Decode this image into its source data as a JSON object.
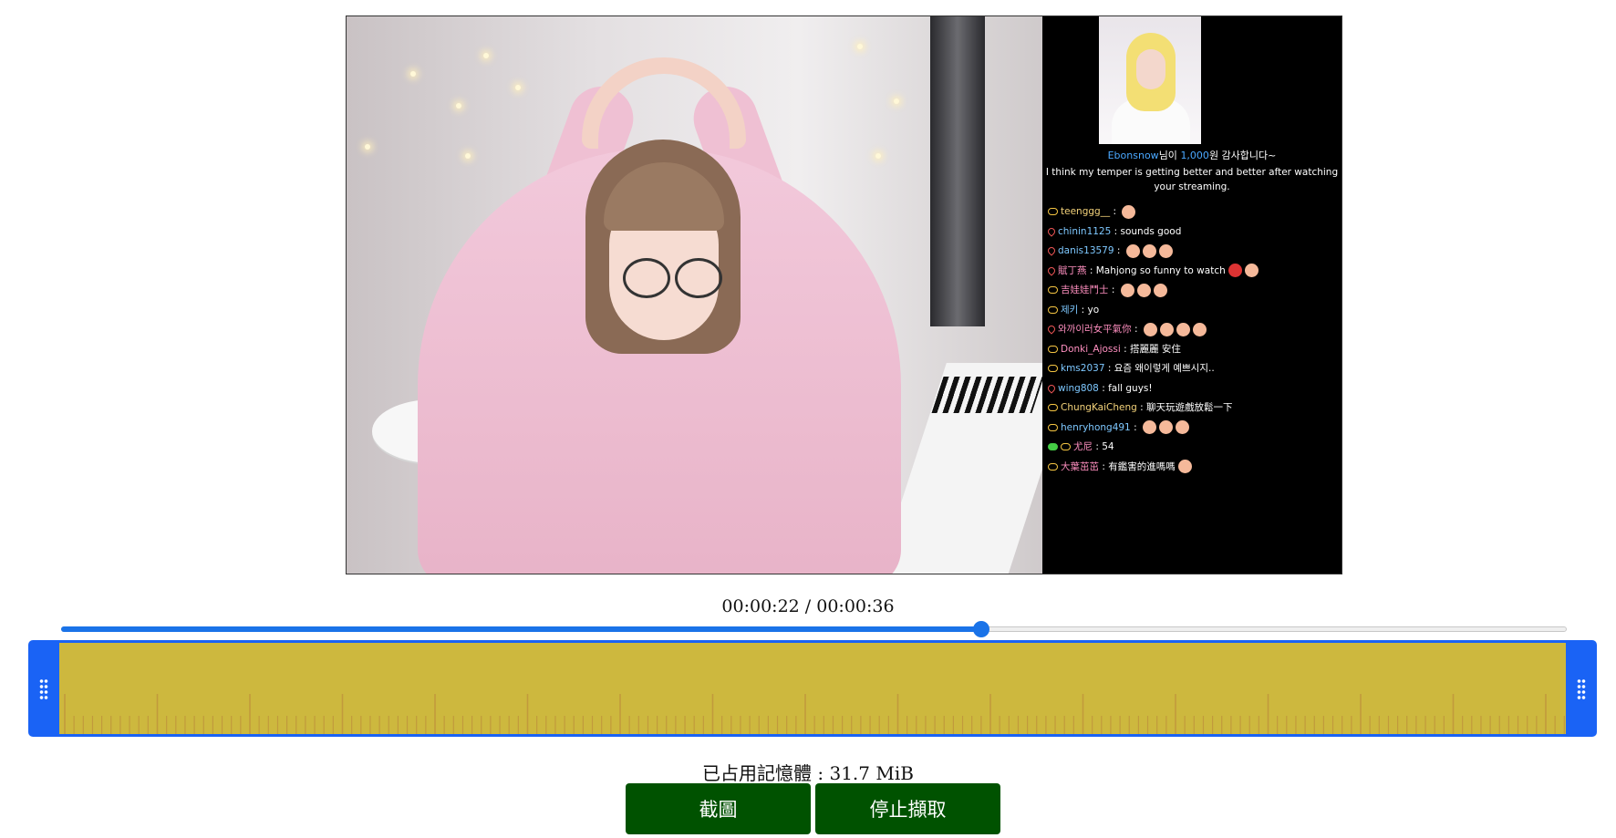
{
  "video": {
    "chat": {
      "donation": {
        "user": "Ebonsnow",
        "text_before": "님이 ",
        "amount": "1,000",
        "text_after": "원 감사합니다~",
        "message": "I think my temper is getting better and better after watching your streaming."
      },
      "messages": [
        {
          "user": "teenggg__",
          "text": " : "
        },
        {
          "user": "chinin1125",
          "text": " : sounds good"
        },
        {
          "user": "danis13579",
          "text": " : "
        },
        {
          "user": "賦丁燕",
          "text": " : Mahjong so funny to watch"
        },
        {
          "user": "吉娃娃鬥士",
          "text": " : "
        },
        {
          "user": "제키",
          "text": " : yo"
        },
        {
          "user": "와까이러女平氣你",
          "text": " : "
        },
        {
          "user": "Donki_Ajossi",
          "text": " : 搭麗麗 安住"
        },
        {
          "user": "kms2037",
          "text": " : 요즘 왜이렇게 예쁘시지.."
        },
        {
          "user": "wing808",
          "text": " : fall guys!"
        },
        {
          "user": "ChungKaiCheng",
          "text": " : 聊天玩遊戲放鬆一下"
        },
        {
          "user": "henryhong491",
          "text": " : "
        },
        {
          "user": "尤尼",
          "text": " : 54"
        },
        {
          "user": "大葉茁茁",
          "text": " : 有鑑害的進嗎嗎"
        }
      ]
    }
  },
  "player": {
    "time_display": "00:00:22 / 00:00:36",
    "current_seconds": 22,
    "total_seconds": 36,
    "accent_color": "#1a73e8"
  },
  "range_editor": {
    "frame_color": "#1a63f5",
    "strip_color": "#cdb83e"
  },
  "footer": {
    "memory_text": "已占用記憶體 : 31.7 MiB",
    "screenshot_label": "截圖",
    "stop_label": "停止擷取",
    "button_color": "#005200"
  }
}
